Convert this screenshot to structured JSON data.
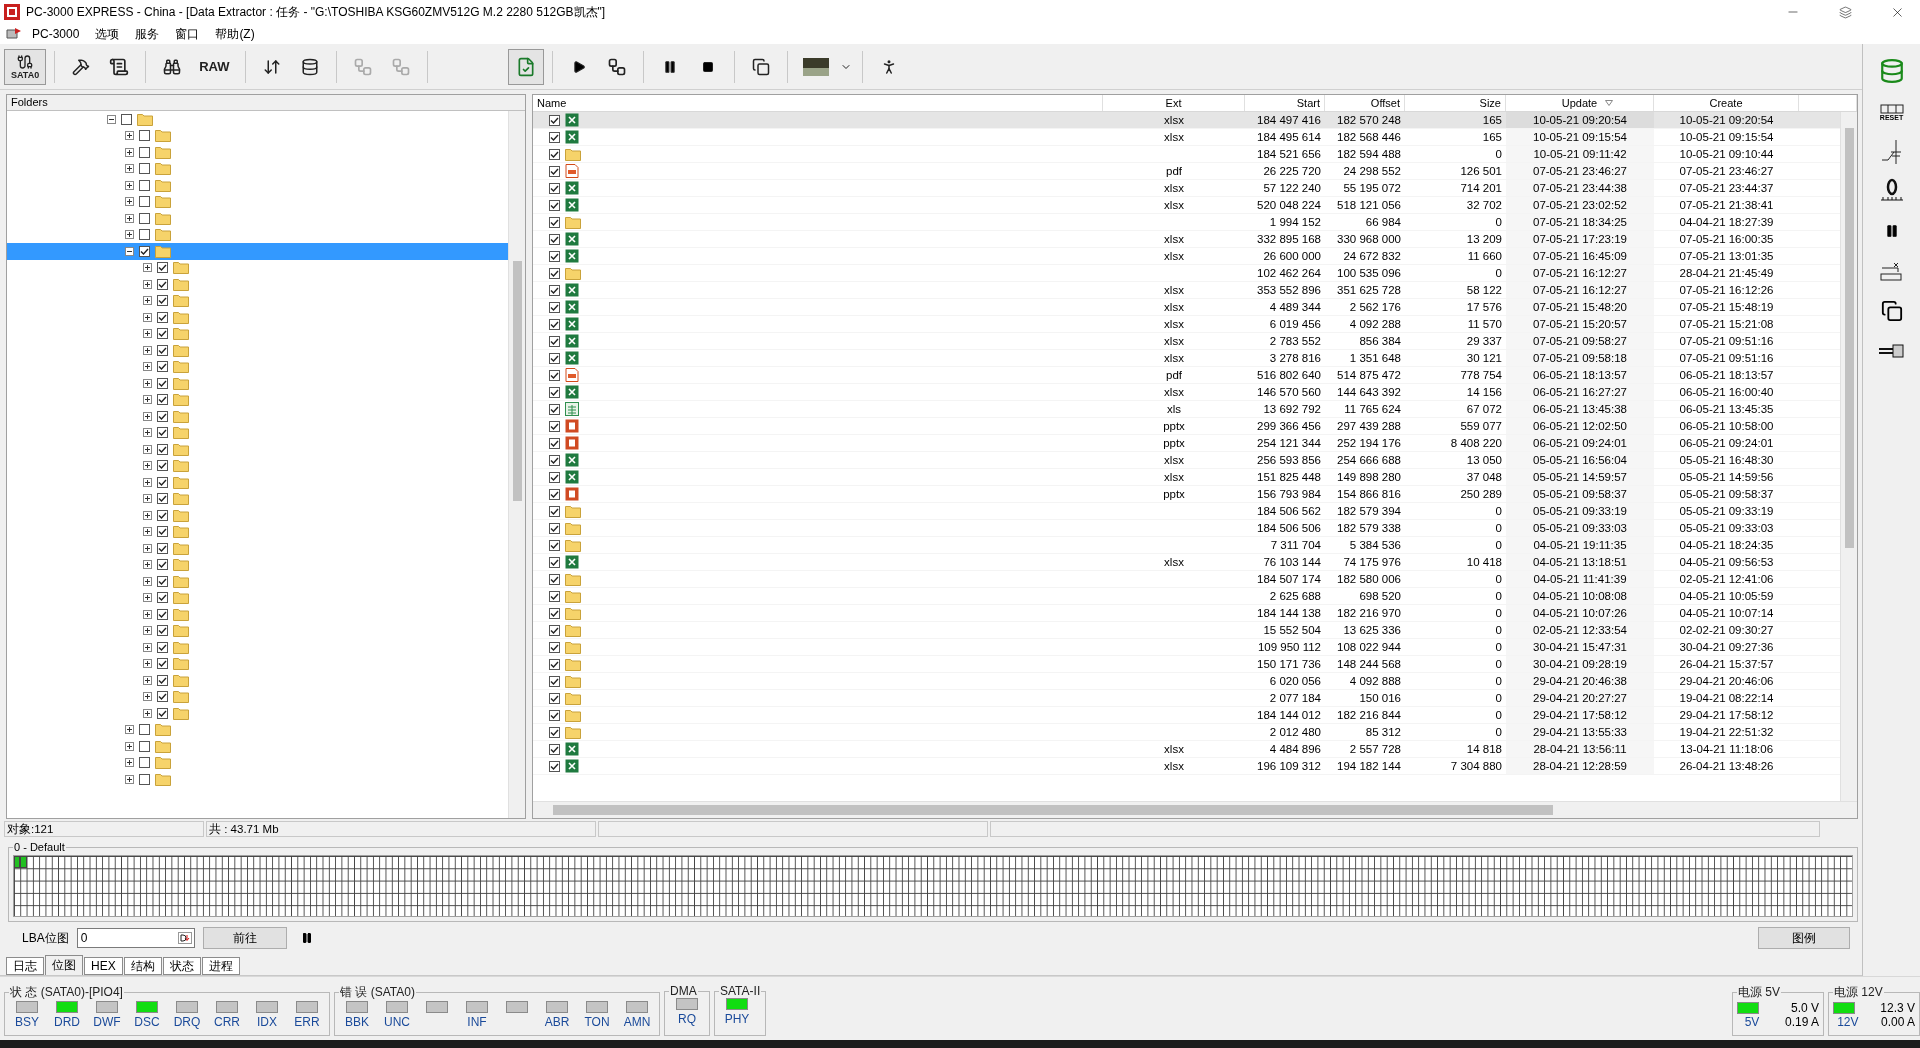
{
  "window": {
    "title": "PC-3000 EXPRESS - China - [Data Extractor : 任务 - \"G:\\TOSHIBA KSG60ZMV512G M.2 2280 512GB凯杰\"]"
  },
  "menu": [
    "PC-3000",
    "选项",
    "服务",
    "窗口",
    "帮助(Z)"
  ],
  "toolbar": {
    "port_label": "SATA0",
    "raw_label": "RAW"
  },
  "tree": {
    "header": "Folders",
    "items": [
      {
        "checked": false,
        "expanded": true,
        "selected": false,
        "children": [
          {
            "checked": false,
            "expanded": false,
            "selected": false
          },
          {
            "checked": false,
            "expanded": false,
            "selected": false
          },
          {
            "checked": false,
            "expanded": false,
            "selected": false
          },
          {
            "checked": false,
            "expanded": false,
            "selected": false
          },
          {
            "checked": false,
            "expanded": false,
            "selected": false
          },
          {
            "checked": false,
            "expanded": false,
            "selected": false
          },
          {
            "checked": false,
            "expanded": false,
            "selected": false
          },
          {
            "checked": true,
            "expanded": true,
            "selected": true,
            "children": [
              {
                "checked": true,
                "expanded": false,
                "selected": false
              },
              {
                "checked": true,
                "expanded": false,
                "selected": false
              },
              {
                "checked": true,
                "expanded": false,
                "selected": false
              },
              {
                "checked": true,
                "expanded": false,
                "selected": false
              },
              {
                "checked": true,
                "expanded": false,
                "selected": false
              },
              {
                "checked": true,
                "expanded": false,
                "selected": false
              },
              {
                "checked": true,
                "expanded": false,
                "selected": false
              },
              {
                "checked": true,
                "expanded": false,
                "selected": false
              },
              {
                "checked": true,
                "expanded": false,
                "selected": false
              },
              {
                "checked": true,
                "expanded": false,
                "selected": false
              },
              {
                "checked": true,
                "expanded": false,
                "selected": false
              },
              {
                "checked": true,
                "expanded": false,
                "selected": false
              },
              {
                "checked": true,
                "expanded": false,
                "selected": false
              },
              {
                "checked": true,
                "expanded": false,
                "selected": false
              },
              {
                "checked": true,
                "expanded": false,
                "selected": false
              },
              {
                "checked": true,
                "expanded": false,
                "selected": false
              },
              {
                "checked": true,
                "expanded": false,
                "selected": false
              },
              {
                "checked": true,
                "expanded": false,
                "selected": false
              },
              {
                "checked": true,
                "expanded": false,
                "selected": false
              },
              {
                "checked": true,
                "expanded": false,
                "selected": false
              },
              {
                "checked": true,
                "expanded": false,
                "selected": false
              },
              {
                "checked": true,
                "expanded": false,
                "selected": false
              },
              {
                "checked": true,
                "expanded": false,
                "selected": false
              },
              {
                "checked": true,
                "expanded": false,
                "selected": false
              },
              {
                "checked": true,
                "expanded": false,
                "selected": false
              },
              {
                "checked": true,
                "expanded": false,
                "selected": false
              },
              {
                "checked": true,
                "expanded": false,
                "selected": false
              },
              {
                "checked": true,
                "expanded": false,
                "selected": false
              }
            ]
          },
          {
            "checked": false,
            "expanded": false,
            "selected": false
          },
          {
            "checked": false,
            "expanded": false,
            "selected": false
          },
          {
            "checked": false,
            "expanded": false,
            "selected": false
          },
          {
            "checked": false,
            "expanded": false,
            "selected": false
          }
        ]
      }
    ]
  },
  "table": {
    "columns": [
      {
        "label": "Name",
        "sorted": false
      },
      {
        "label": "Ext",
        "sorted": false
      },
      {
        "label": "Start",
        "sorted": false
      },
      {
        "label": "Offset",
        "sorted": false
      },
      {
        "label": "Size",
        "sorted": false
      },
      {
        "label": "Update",
        "sorted": true
      },
      {
        "label": "Create",
        "sorted": false
      }
    ],
    "rows": [
      {
        "kind": "excel",
        "checked": true,
        "selected": true,
        "ext": "xlsx",
        "start": "184 497 416",
        "offset": "182 570 248",
        "size": "165",
        "update": "10-05-21 09:20:54",
        "create": "10-05-21 09:20:54"
      },
      {
        "kind": "excel",
        "checked": true,
        "selected": false,
        "ext": "xlsx",
        "start": "184 495 614",
        "offset": "182 568 446",
        "size": "165",
        "update": "10-05-21 09:15:54",
        "create": "10-05-21 09:15:54"
      },
      {
        "kind": "folder",
        "checked": true,
        "selected": false,
        "start": "184 521 656",
        "offset": "182 594 488",
        "size": "0",
        "update": "10-05-21 09:11:42",
        "create": "10-05-21 09:10:44"
      },
      {
        "kind": "pdf",
        "checked": true,
        "selected": false,
        "ext": "pdf",
        "start": "26 225 720",
        "offset": "24 298 552",
        "size": "126 501",
        "update": "07-05-21 23:46:27",
        "create": "07-05-21 23:46:27"
      },
      {
        "kind": "excel",
        "checked": true,
        "selected": false,
        "ext": "xlsx",
        "start": "57 122 240",
        "offset": "55 195 072",
        "size": "714 201",
        "update": "07-05-21 23:44:38",
        "create": "07-05-21 23:44:37"
      },
      {
        "kind": "excel",
        "checked": true,
        "selected": false,
        "ext": "xlsx",
        "start": "520 048 224",
        "offset": "518 121 056",
        "size": "32 702",
        "update": "07-05-21 23:02:52",
        "create": "07-05-21 21:38:41"
      },
      {
        "kind": "folder",
        "checked": true,
        "selected": false,
        "start": "1 994 152",
        "offset": "66 984",
        "size": "0",
        "update": "07-05-21 18:34:25",
        "create": "04-04-21 18:27:39"
      },
      {
        "kind": "excel",
        "checked": true,
        "selected": false,
        "ext": "xlsx",
        "start": "332 895 168",
        "offset": "330 968 000",
        "size": "13 209",
        "update": "07-05-21 17:23:19",
        "create": "07-05-21 16:00:35"
      },
      {
        "kind": "excel",
        "checked": true,
        "selected": false,
        "ext": "xlsx",
        "start": "26 600 000",
        "offset": "24 672 832",
        "size": "11 660",
        "update": "07-05-21 16:45:09",
        "create": "07-05-21 13:01:35"
      },
      {
        "kind": "folder",
        "checked": true,
        "selected": false,
        "start": "102 462 264",
        "offset": "100 535 096",
        "size": "0",
        "update": "07-05-21 16:12:27",
        "create": "28-04-21 21:45:49"
      },
      {
        "kind": "excel",
        "checked": true,
        "selected": false,
        "ext": "xlsx",
        "start": "353 552 896",
        "offset": "351 625 728",
        "size": "58 122",
        "update": "07-05-21 16:12:27",
        "create": "07-05-21 16:12:26"
      },
      {
        "kind": "excel",
        "checked": true,
        "selected": false,
        "ext": "xlsx",
        "start": "4 489 344",
        "offset": "2 562 176",
        "size": "17 576",
        "update": "07-05-21 15:48:20",
        "create": "07-05-21 15:48:19"
      },
      {
        "kind": "excel",
        "checked": true,
        "selected": false,
        "ext": "xlsx",
        "start": "6 019 456",
        "offset": "4 092 288",
        "size": "11 570",
        "update": "07-05-21 15:20:57",
        "create": "07-05-21 15:21:08"
      },
      {
        "kind": "excel",
        "checked": true,
        "selected": false,
        "ext": "xlsx",
        "start": "2 783 552",
        "offset": "856 384",
        "size": "29 337",
        "update": "07-05-21 09:58:27",
        "create": "07-05-21 09:51:16"
      },
      {
        "kind": "excel",
        "checked": true,
        "selected": false,
        "ext": "xlsx",
        "start": "3 278 816",
        "offset": "1 351 648",
        "size": "30 121",
        "update": "07-05-21 09:58:18",
        "create": "07-05-21 09:51:16"
      },
      {
        "kind": "pdf",
        "checked": true,
        "selected": false,
        "ext": "pdf",
        "start": "516 802 640",
        "offset": "514 875 472",
        "size": "778 754",
        "update": "06-05-21 18:13:57",
        "create": "06-05-21 18:13:57"
      },
      {
        "kind": "excel",
        "checked": true,
        "selected": false,
        "ext": "xlsx",
        "start": "146 570 560",
        "offset": "144 643 392",
        "size": "14 156",
        "update": "06-05-21 16:27:27",
        "create": "06-05-21 16:00:40"
      },
      {
        "kind": "sheet",
        "checked": true,
        "selected": false,
        "ext": "xls",
        "start": "13 692 792",
        "offset": "11 765 624",
        "size": "67 072",
        "update": "06-05-21 13:45:38",
        "create": "06-05-21 13:45:35"
      },
      {
        "kind": "slides",
        "checked": true,
        "selected": false,
        "ext": "pptx",
        "start": "299 366 456",
        "offset": "297 439 288",
        "size": "559 077",
        "update": "06-05-21 12:02:50",
        "create": "06-05-21 10:58:00"
      },
      {
        "kind": "slides",
        "checked": true,
        "selected": false,
        "ext": "pptx",
        "start": "254 121 344",
        "offset": "252 194 176",
        "size": "8 408 220",
        "update": "06-05-21 09:24:01",
        "create": "06-05-21 09:24:01"
      },
      {
        "kind": "excel",
        "checked": true,
        "selected": false,
        "ext": "xlsx",
        "start": "256 593 856",
        "offset": "254 666 688",
        "size": "13 050",
        "update": "05-05-21 16:56:04",
        "create": "05-05-21 16:48:30"
      },
      {
        "kind": "excel",
        "checked": true,
        "selected": false,
        "ext": "xlsx",
        "start": "151 825 448",
        "offset": "149 898 280",
        "size": "37 048",
        "update": "05-05-21 14:59:57",
        "create": "05-05-21 14:59:56"
      },
      {
        "kind": "slides",
        "checked": true,
        "selected": false,
        "ext": "pptx",
        "start": "156 793 984",
        "offset": "154 866 816",
        "size": "250 289",
        "update": "05-05-21 09:58:37",
        "create": "05-05-21 09:58:37"
      },
      {
        "kind": "folder",
        "checked": true,
        "selected": false,
        "start": "184 506 562",
        "offset": "182 579 394",
        "size": "0",
        "update": "05-05-21 09:33:19",
        "create": "05-05-21 09:33:19"
      },
      {
        "kind": "folder",
        "checked": true,
        "selected": false,
        "start": "184 506 506",
        "offset": "182 579 338",
        "size": "0",
        "update": "05-05-21 09:33:03",
        "create": "05-05-21 09:33:03"
      },
      {
        "kind": "folder",
        "checked": true,
        "selected": false,
        "start": "7 311 704",
        "offset": "5 384 536",
        "size": "0",
        "update": "04-05-21 19:11:35",
        "create": "04-05-21 18:24:35"
      },
      {
        "kind": "excel",
        "checked": true,
        "selected": false,
        "ext": "xlsx",
        "start": "76 103 144",
        "offset": "74 175 976",
        "size": "10 418",
        "update": "04-05-21 13:18:51",
        "create": "04-05-21 09:56:53"
      },
      {
        "kind": "folder",
        "checked": true,
        "selected": false,
        "start": "184 507 174",
        "offset": "182 580 006",
        "size": "0",
        "update": "04-05-21 11:41:39",
        "create": "02-05-21 12:41:06"
      },
      {
        "kind": "folder",
        "checked": true,
        "selected": false,
        "start": "2 625 688",
        "offset": "698 520",
        "size": "0",
        "update": "04-05-21 10:08:08",
        "create": "04-05-21 10:05:59"
      },
      {
        "kind": "folder",
        "checked": true,
        "selected": false,
        "start": "184 144 138",
        "offset": "182 216 970",
        "size": "0",
        "update": "04-05-21 10:07:26",
        "create": "04-05-21 10:07:14"
      },
      {
        "kind": "folder",
        "checked": true,
        "selected": false,
        "start": "15 552 504",
        "offset": "13 625 336",
        "size": "0",
        "update": "02-05-21 12:33:54",
        "create": "02-02-21 09:30:27"
      },
      {
        "kind": "folder",
        "checked": true,
        "selected": false,
        "start": "109 950 112",
        "offset": "108 022 944",
        "size": "0",
        "update": "30-04-21 15:47:31",
        "create": "30-04-21 09:27:36"
      },
      {
        "kind": "folder",
        "checked": true,
        "selected": false,
        "start": "150 171 736",
        "offset": "148 244 568",
        "size": "0",
        "update": "30-04-21 09:28:19",
        "create": "26-04-21 15:37:57"
      },
      {
        "kind": "folder",
        "checked": true,
        "selected": false,
        "start": "6 020 056",
        "offset": "4 092 888",
        "size": "0",
        "update": "29-04-21 20:46:38",
        "create": "29-04-21 20:46:06"
      },
      {
        "kind": "folder",
        "checked": true,
        "selected": false,
        "start": "2 077 184",
        "offset": "150 016",
        "size": "0",
        "update": "29-04-21 20:27:27",
        "create": "19-04-21 08:22:14"
      },
      {
        "kind": "folder",
        "checked": true,
        "selected": false,
        "start": "184 144 012",
        "offset": "182 216 844",
        "size": "0",
        "update": "29-04-21 17:58:12",
        "create": "29-04-21 17:58:12"
      },
      {
        "kind": "folder",
        "checked": true,
        "selected": false,
        "start": "2 012 480",
        "offset": "85 312",
        "size": "0",
        "update": "29-04-21 13:55:33",
        "create": "19-04-21 22:51:32"
      },
      {
        "kind": "excel",
        "checked": true,
        "selected": false,
        "ext": "xlsx",
        "start": "4 484 896",
        "offset": "2 557 728",
        "size": "14 818",
        "update": "28-04-21 13:56:11",
        "create": "13-04-21 11:18:06"
      },
      {
        "kind": "excel",
        "checked": true,
        "selected": false,
        "ext": "xlsx",
        "start": "196 109 312",
        "offset": "194 182 144",
        "size": "7 304 880",
        "update": "28-04-21 12:28:59",
        "create": "26-04-21 13:48:26"
      }
    ]
  },
  "status": [
    "对象:121",
    "共 : 43.71 Mb"
  ],
  "bitmap": {
    "title": "0 - Default",
    "filled": [
      {
        "kind": "read"
      },
      {
        "kind": "read"
      }
    ]
  },
  "lba": {
    "label": "LBA位图",
    "value": "0",
    "go_button": "前往"
  },
  "legend_button": "图例",
  "tabs": [
    {
      "label": "日志",
      "selected": false
    },
    {
      "label": "位图",
      "selected": true
    },
    {
      "label": "HEX",
      "selected": false
    },
    {
      "label": "结构",
      "selected": false
    },
    {
      "label": "状态",
      "selected": false
    },
    {
      "label": "进程",
      "selected": false
    }
  ],
  "side_toolbar": {
    "reset_label": "RESET"
  },
  "indicator_groups": [
    {
      "title": "状 态 (SATA0)-[PIO4]",
      "lamps": [
        {
          "label": "BSY",
          "on": false
        },
        {
          "label": "DRD",
          "on": true
        },
        {
          "label": "DWF",
          "on": false
        },
        {
          "label": "DSC",
          "on": true
        },
        {
          "label": "DRQ",
          "on": false
        },
        {
          "label": "CRR",
          "on": false
        },
        {
          "label": "IDX",
          "on": false
        },
        {
          "label": "ERR",
          "on": false
        }
      ]
    },
    {
      "title": "错 误 (SATA0)",
      "lamps": [
        {
          "label": "BBK",
          "on": false
        },
        {
          "label": "UNC",
          "on": false
        },
        {
          "on": false
        },
        {
          "label": "INF",
          "on": false
        },
        {
          "on": false
        },
        {
          "label": "ABR",
          "on": false
        },
        {
          "label": "TON",
          "on": false
        },
        {
          "label": "AMN",
          "on": false
        }
      ]
    },
    {
      "title": "DMA",
      "lamps": [
        {
          "label": "RQ",
          "on": false
        }
      ]
    },
    {
      "title": "SATA-II",
      "lamps": [
        {
          "label": "PHY",
          "on": true
        }
      ]
    }
  ],
  "power": [
    {
      "title": "电源 5V",
      "on": true,
      "label": "5V",
      "voltage": "5.0 V",
      "current": "0.19 A"
    },
    {
      "title": "电源 12V",
      "on": true,
      "label": "12V",
      "voltage": "12.3 V",
      "current": "0.00 A"
    }
  ]
}
